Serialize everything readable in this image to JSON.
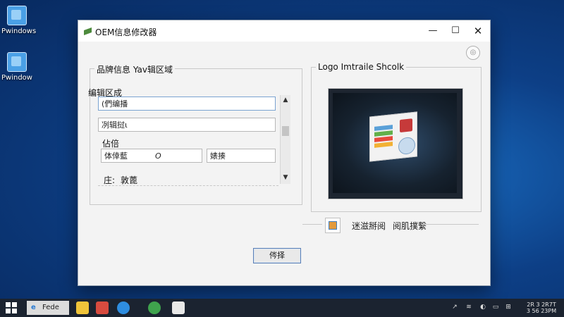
{
  "desktop": {
    "icons": [
      {
        "label": "Pwindows"
      },
      {
        "label": "Pwindow"
      }
    ]
  },
  "window": {
    "title": "OEM信息修改器",
    "controls": {
      "minimize": "—",
      "maximize": "☐",
      "close": "✕"
    }
  },
  "left_group": {
    "title": "品牌信息 Yav辑区域",
    "sub_title": "编辑区成",
    "field1_value": "(們编播",
    "field2_value": "冽辑挝ι",
    "section_label": "佔倍",
    "field3_value": "体倖藍",
    "field3_suffix": "O",
    "field4_value": "婊揍",
    "footer_label": "庄:",
    "footer_value": "敦蓖"
  },
  "ok_button": {
    "label": "侺择"
  },
  "right_group": {
    "title": "Logo Imtraile Shcolk",
    "choose_logo": "迷滋掰阅",
    "hint": "阅肌撲繫"
  },
  "taskbar": {
    "search_text": "Fede",
    "clock_line1": "2R 3 2R7T",
    "clock_line2": "3 56 23PM",
    "accent": "#1b2330"
  }
}
